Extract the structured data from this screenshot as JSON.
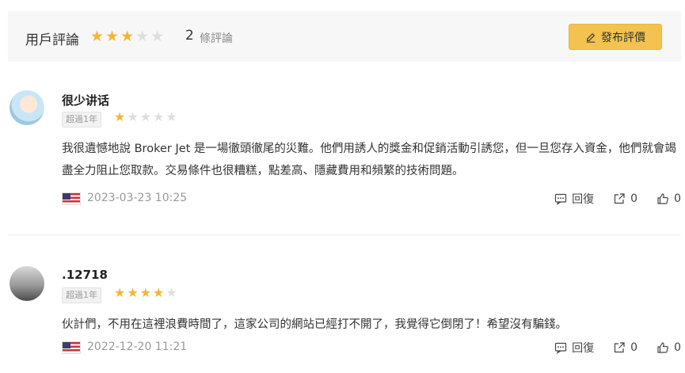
{
  "header": {
    "title": "用戶評論",
    "rating": 3,
    "max_rating": 5,
    "count": "2",
    "count_label": "條評論",
    "write_button_label": "發布評價"
  },
  "reviews": [
    {
      "username": "很少讲话",
      "tenure": "超過1年",
      "rating": 1,
      "text": "我很遺憾地說 Broker Jet 是一場徹頭徹尾的災難。他們用誘人的獎金和促銷活動引誘您，但一旦您存入資金，他們就會竭盡全力阻止您取款。交易條件也很糟糕，點差高、隱藏費用和頻繁的技術問題。",
      "date": "2023-03-23 10:25",
      "reply_label": "回復",
      "share_count": "0",
      "like_count": "0"
    },
    {
      "username": ".12718",
      "tenure": "超過1年",
      "rating": 4,
      "text": "伙計們，不用在這裡浪費時間了，這家公司的網站已經打不開了，我覺得它倒閉了！希望沒有騙錢。",
      "date": "2022-12-20 11:21",
      "reply_label": "回復",
      "share_count": "0",
      "like_count": "0"
    }
  ],
  "colors": {
    "star_on": "#f2b632",
    "star_off": "#dedede",
    "button_bg": "#f3c24f"
  },
  "icons": [
    "pen-icon",
    "star-icon",
    "us-flag-icon",
    "comment-icon",
    "share-icon",
    "thumbs-up-icon"
  ]
}
